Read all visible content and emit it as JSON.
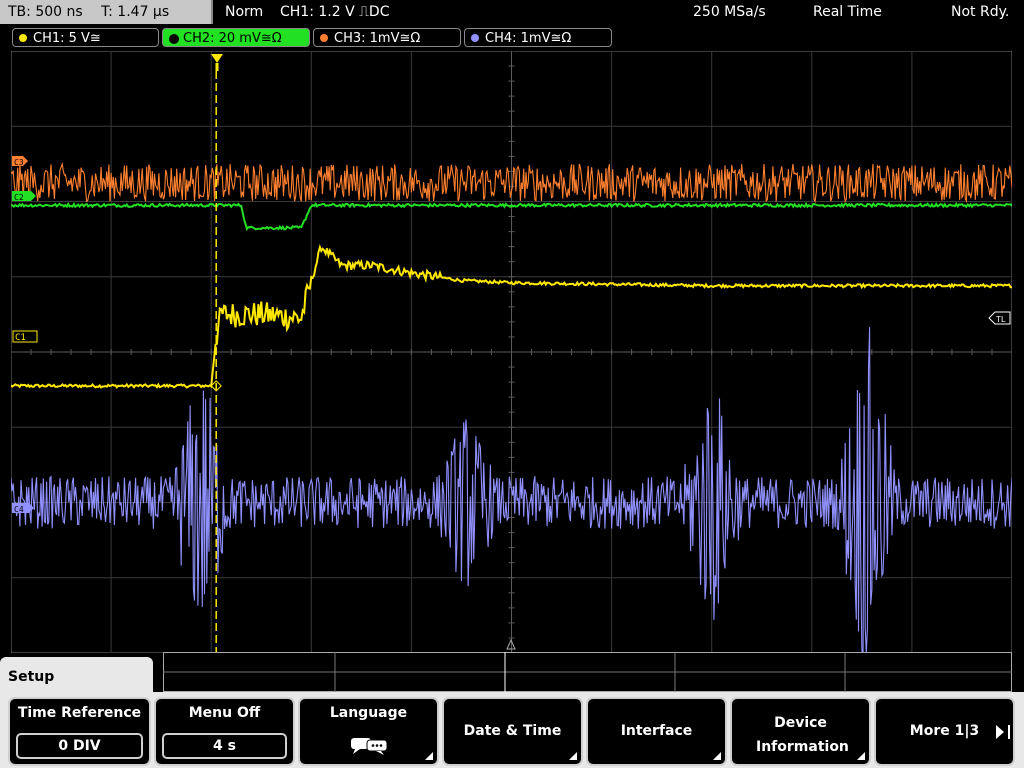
{
  "top_left": {
    "timebase": "TB: 500 ns",
    "trigger_time": "T: 1.47 µs"
  },
  "status": {
    "mode": "Norm",
    "trigger": "CH1: 1.2 V ⎍DC",
    "sample_rate": "250 MSa/s",
    "acquisition": "Real Time",
    "state": "Not Rdy."
  },
  "channels": [
    {
      "label": "CH1: 5 V≅",
      "color": "#ffe800",
      "active": false
    },
    {
      "label": "CH2: 20 mV≅Ω",
      "color": "#22e022",
      "active": true
    },
    {
      "label": "CH3: 1mV≅Ω",
      "color": "#ff8030",
      "active": false
    },
    {
      "label": "CH4: 1mV≅Ω",
      "color": "#9090ff",
      "active": false
    }
  ],
  "markers": {
    "ch1": "C1",
    "ch2": "C2",
    "trigger_level": "TL",
    "c4": "C4"
  },
  "menu": {
    "title": "Setup",
    "time_reference": {
      "label": "Time Reference",
      "value": "0 DIV"
    },
    "menu_off": {
      "label": "Menu Off",
      "value": "4 s"
    },
    "language": {
      "label": "Language"
    },
    "date_time": {
      "label": "Date & Time"
    },
    "interface": {
      "label": "Interface"
    },
    "device_info": {
      "label": "Device Information"
    },
    "more": {
      "label": "More 1|3"
    }
  },
  "chart_data": {
    "type": "line",
    "grid": true,
    "divisions_x": 10,
    "divisions_y": 8,
    "x_unit": "div",
    "y_unit": "div",
    "trigger_x_div": 2.05,
    "series": [
      {
        "name": "CH1",
        "color": "#ffe800",
        "x": [
          0,
          2.0,
          2.05,
          2.1,
          2.5,
          2.9,
          3.0,
          3.1,
          3.3,
          3.6,
          4.0,
          4.5,
          5.0,
          6.0,
          7.0,
          8.0,
          9.0,
          10.0
        ],
        "y": [
          -0.45,
          -0.45,
          0.2,
          0.5,
          0.5,
          0.45,
          0.95,
          1.4,
          1.15,
          1.15,
          1.05,
          0.95,
          0.92,
          0.9,
          0.88,
          0.88,
          0.88,
          0.88
        ]
      },
      {
        "name": "CH2",
        "color": "#22e022",
        "x": [
          0,
          2.3,
          2.35,
          2.9,
          3.0,
          10.0
        ],
        "y": [
          1.95,
          1.95,
          1.65,
          1.65,
          1.95,
          1.95
        ]
      },
      {
        "name": "CH3",
        "color": "#ff8030",
        "noise_center": 2.25,
        "noise_amplitude": 0.25
      },
      {
        "name": "CH4",
        "color": "#9090ff",
        "noise_center": -2.0,
        "noise_amplitude": 0.35,
        "bursts": [
          {
            "x": 1.9,
            "amplitude": 1.6
          },
          {
            "x": 4.55,
            "amplitude": 0.9
          },
          {
            "x": 7.0,
            "amplitude": 1.5
          },
          {
            "x": 8.55,
            "amplitude": 2.2
          }
        ]
      }
    ]
  }
}
